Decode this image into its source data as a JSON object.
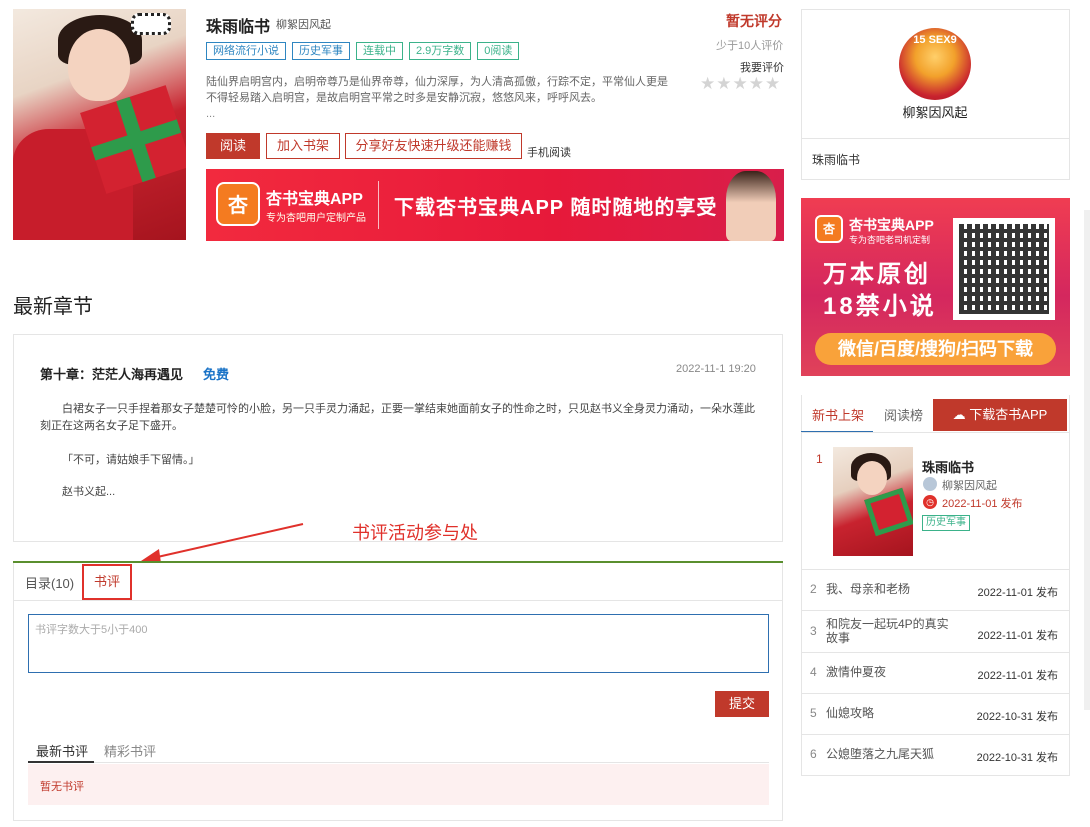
{
  "book": {
    "title": "珠雨临书",
    "author": "柳絮因风起",
    "tags": [
      "网络流行小说",
      "历史军事",
      "连载中",
      "2.9万字数",
      "0阅读"
    ],
    "description": "陆仙界启明宫内，启明帝尊乃是仙界帝尊，仙力深厚，为人清高孤傲，行踪不定，平常仙人更是不得轻易踏入启明宫，是故启明宫平常之时多是安静沉寂，悠悠风来，呼呼风去。",
    "description_more": "...",
    "buttons": {
      "read": "阅读",
      "add_shelf": "加入书架",
      "share": "分享好友快速升级还能赚钱",
      "mobile": "手机阅读"
    }
  },
  "rating": {
    "status": "暂无评分",
    "sub": "少于10人评价",
    "rate_link": "我要评价",
    "stars": [
      "★",
      "★",
      "★",
      "★",
      "★"
    ]
  },
  "banner_top": {
    "logo": "杏",
    "app_name": "杏书宝典APP",
    "app_sub": "专为杏吧用户定制产品",
    "slogan": "下载杏书宝典APP 随时随地的享受"
  },
  "latest": {
    "section_title": "最新章节",
    "chapter_title": "第十章：茫茫人海再遇见",
    "free_label": "免费",
    "date": "2022-11-1 19:20",
    "text": "白裙女子一只手捏着那女子楚楚可怜的小脸，另一只手灵力涌起，正要一掌结束她面前女子的性命之时，只见赵书义全身灵力涌动，一朵水莲此刻正在这两名女子足下盛开。",
    "quote": "「不可，请姑娘手下留情。」",
    "ending": "赵书义起..."
  },
  "annotation": "书评活动参与处",
  "tabs": {
    "catalog": "目录(10)",
    "review": "书评"
  },
  "review_form": {
    "placeholder": "书评字数大于5小于400",
    "submit": "提交",
    "sub_tabs": [
      "最新书评",
      "精彩书评"
    ],
    "empty": "暂无书评"
  },
  "author_card": {
    "avatar_text": "15 SEX9",
    "name": "柳絮因风起",
    "book": "珠雨临书"
  },
  "banner_side": {
    "logo": "杏",
    "name": "杏书宝典APP",
    "sub": "专为杏吧老司机定制",
    "line1": "万本原创",
    "line2": "18禁小说",
    "cta": "微信/百度/搜狗/扫码下载"
  },
  "rank": {
    "tab_new": "新书上架",
    "tab_read": "阅读榜",
    "download": "下载杏书APP",
    "first": {
      "num": "1",
      "title": "珠雨临书",
      "author": "柳絮因风起",
      "date": "2022-11-01 发布",
      "tag": "历史军事"
    },
    "items": [
      {
        "num": "2",
        "title": "我、母亲和老杨",
        "date": "2022-11-01 发布"
      },
      {
        "num": "3",
        "title": "和院友一起玩4P的真实故事",
        "date": "2022-11-01 发布"
      },
      {
        "num": "4",
        "title": "激情仲夏夜",
        "date": "2022-11-01 发布"
      },
      {
        "num": "5",
        "title": "仙媳攻略",
        "date": "2022-10-31 发布"
      },
      {
        "num": "6",
        "title": "公媳堕落之九尾天狐",
        "date": "2022-10-31 发布"
      }
    ]
  },
  "colors": {
    "accent": "#c0392b",
    "link_blue": "#2e86c1",
    "tag_green": "#3bb28a"
  }
}
